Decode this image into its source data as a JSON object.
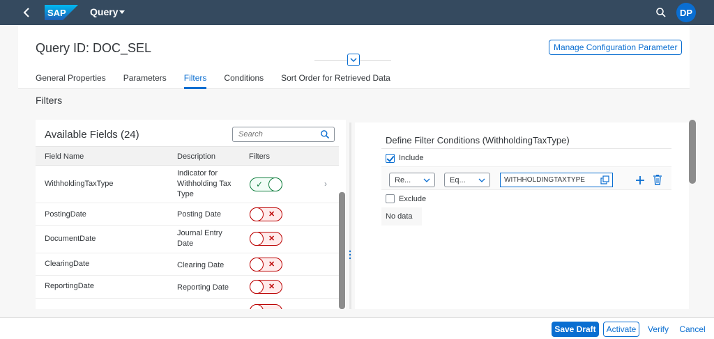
{
  "shell": {
    "logo_text": "SAP",
    "app_title": "Query",
    "avatar_initials": "DP"
  },
  "header": {
    "title": "Query ID: DOC_SEL",
    "manage_button": "Manage Configuration Parameter",
    "tabs": [
      {
        "label": "General Properties",
        "selected": false
      },
      {
        "label": "Parameters",
        "selected": false
      },
      {
        "label": "Filters",
        "selected": true
      },
      {
        "label": "Conditions",
        "selected": false
      },
      {
        "label": "Sort Order for Retrieved Data",
        "selected": false
      }
    ]
  },
  "section_title": "Filters",
  "available_fields": {
    "title": "Available Fields (24)",
    "search_placeholder": "Search",
    "columns": [
      "Field Name",
      "Description",
      "Filters"
    ],
    "rows": [
      {
        "name": "WithholdingTaxType",
        "description": "Indicator for Withholding Tax Type",
        "filter_on": true
      },
      {
        "name": "PostingDate",
        "description": "Posting Date",
        "filter_on": false
      },
      {
        "name": "DocumentDate",
        "description": "Journal Entry Date",
        "filter_on": false
      },
      {
        "name": "ClearingDate",
        "description": "Clearing Date",
        "filter_on": false
      },
      {
        "name": "ReportingDate",
        "description": "Reporting Date",
        "filter_on": false
      }
    ]
  },
  "filter_conditions": {
    "title": "Define Filter Conditions (WithholdingTaxType)",
    "include_label": "Include",
    "include_checked": true,
    "field_select": "Re...",
    "operator_select": "Eq...",
    "value": "WITHHOLDINGTAXTYPE",
    "exclude_label": "Exclude",
    "exclude_checked": false,
    "no_data": "No data"
  },
  "footer": {
    "save_draft": "Save Draft",
    "activate": "Activate",
    "verify": "Verify",
    "cancel": "Cancel"
  },
  "colors": {
    "shell": "#354a5f",
    "accent": "#0a6ed1",
    "positive": "#107e3e",
    "negative": "#bb0000"
  }
}
